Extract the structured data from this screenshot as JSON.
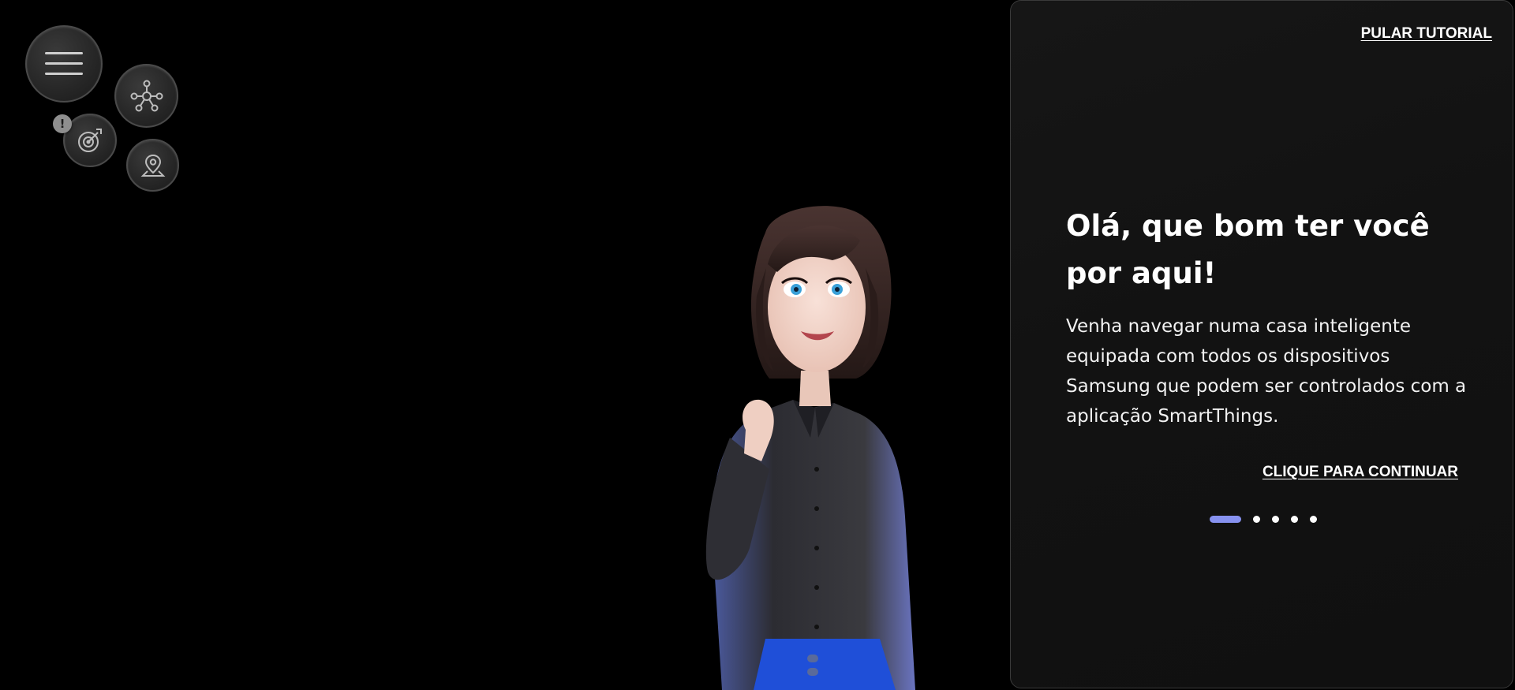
{
  "nav": {
    "buttons": [
      {
        "name": "menu-button",
        "icon": "hamburger-icon"
      },
      {
        "name": "network-button",
        "icon": "network-nodes-icon"
      },
      {
        "name": "target-button",
        "icon": "target-icon"
      },
      {
        "name": "location-button",
        "icon": "map-pin-icon"
      }
    ],
    "alert_badge": "!"
  },
  "panel": {
    "skip_label": "PULAR TUTORIAL",
    "title": "Olá, que bom ter você por aqui!",
    "body": "Venha navegar numa casa inteligente equipada com todos os dispositivos Samsung que podem ser controlados com a aplicação SmartThings.",
    "continue_label": "CLIQUE PARA CONTINUAR",
    "pagination": {
      "total": 5,
      "current": 1
    }
  },
  "colors": {
    "background": "#000000",
    "panel_bg": "#141414",
    "accent": "#8792f0",
    "text": "#ffffff"
  }
}
